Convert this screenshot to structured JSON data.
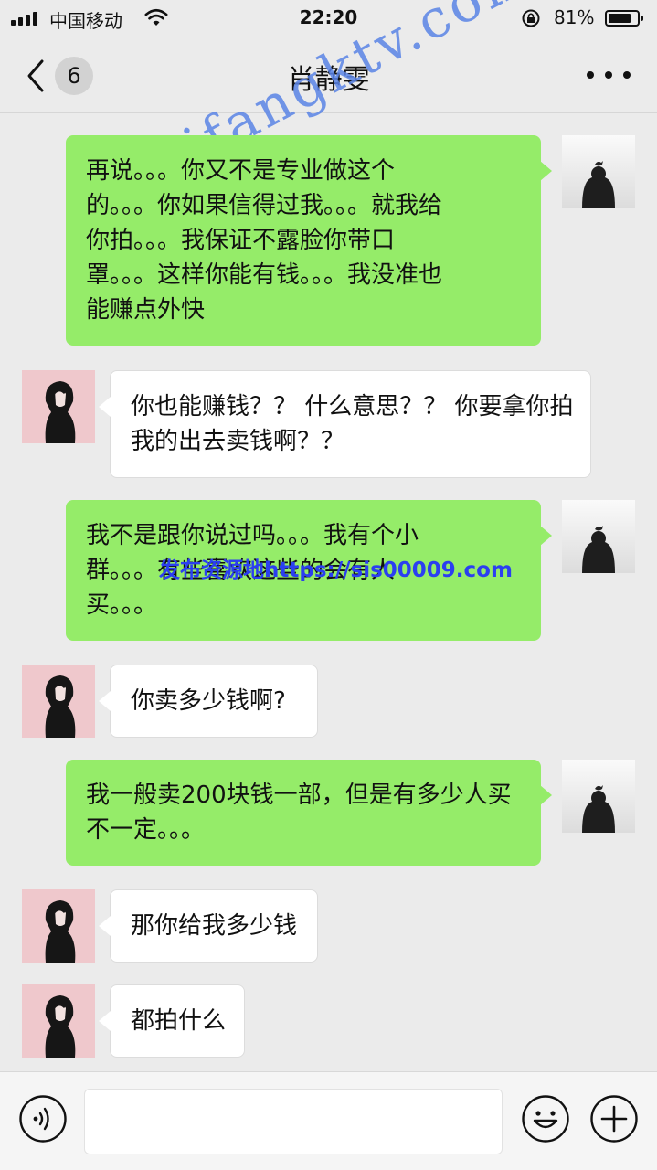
{
  "status_bar": {
    "carrier": "中国移动",
    "time": "22:20",
    "battery_percent": "81%",
    "battery_level": 0.81
  },
  "nav": {
    "unread_count": "6",
    "title": "肖静雯",
    "back_icon": "chevron-left-icon",
    "more_icon": "more-dots-icon"
  },
  "messages": [
    {
      "side": "out",
      "lines": [
        "再说。。。你又不是专业做这个",
        "的。。。你如果信得过我。。。就我给",
        "你拍。。。我保证不露脸你带口",
        "罩。。。这样你能有钱。。。我没准也",
        "能赚点外快"
      ]
    },
    {
      "side": "in",
      "lines": [
        "你也能赚钱？？ 什么意思？？ 你要拿你拍",
        "我的出去卖钱啊？？"
      ]
    },
    {
      "side": "out",
      "lines": [
        "我不是跟你说过吗。。。我有个小",
        "群。。。有些喜欢这些的会有人",
        "买。。。"
      ]
    },
    {
      "side": "in",
      "lines": [
        "你卖多少钱啊?"
      ]
    },
    {
      "side": "out",
      "lines": [
        "我一般卖200块钱一部，但是有多少人买",
        "不一定。。。"
      ]
    },
    {
      "side": "in",
      "lines": [
        "那你给我多少钱"
      ]
    },
    {
      "side": "in",
      "lines": [
        "都拍什么"
      ]
    }
  ],
  "watermarks": {
    "diagonal": "sifangktv.com",
    "inline": "发布资源地https://sis00009.com"
  },
  "input_bar": {
    "voice_icon": "voice-icon",
    "emoji_icon": "emoji-icon",
    "plus_icon": "plus-icon"
  }
}
